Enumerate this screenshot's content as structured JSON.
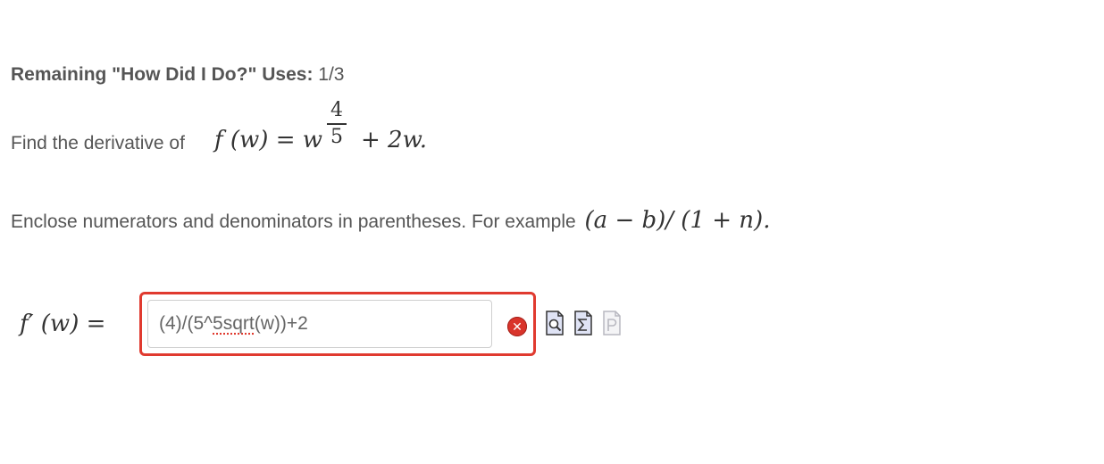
{
  "remaining": {
    "label": "Remaining \"How Did I Do?\" Uses:",
    "value": "1/3"
  },
  "question": {
    "prefix": "Find the derivative of",
    "function_lhs": "f (w) = w",
    "exponent_numerator": "4",
    "exponent_denominator": "5",
    "function_tail": "+ 2w."
  },
  "hint": {
    "text": "Enclose numerators and denominators in parentheses. For example",
    "example": "(a − b)/ (1 + n)."
  },
  "answer": {
    "label": "f′ (w) =",
    "input_value_prefix": "(4)/(5^",
    "input_value_flagged": "5sqrt",
    "input_value_suffix": "(w))+2"
  },
  "icons": {
    "error": "error-x-icon",
    "preview": "preview-document-icon",
    "equation": "equation-editor-icon",
    "help": "help-document-icon"
  },
  "colors": {
    "error_border": "#e03a2f",
    "error_icon": "#d9342b",
    "text": "#555555"
  }
}
